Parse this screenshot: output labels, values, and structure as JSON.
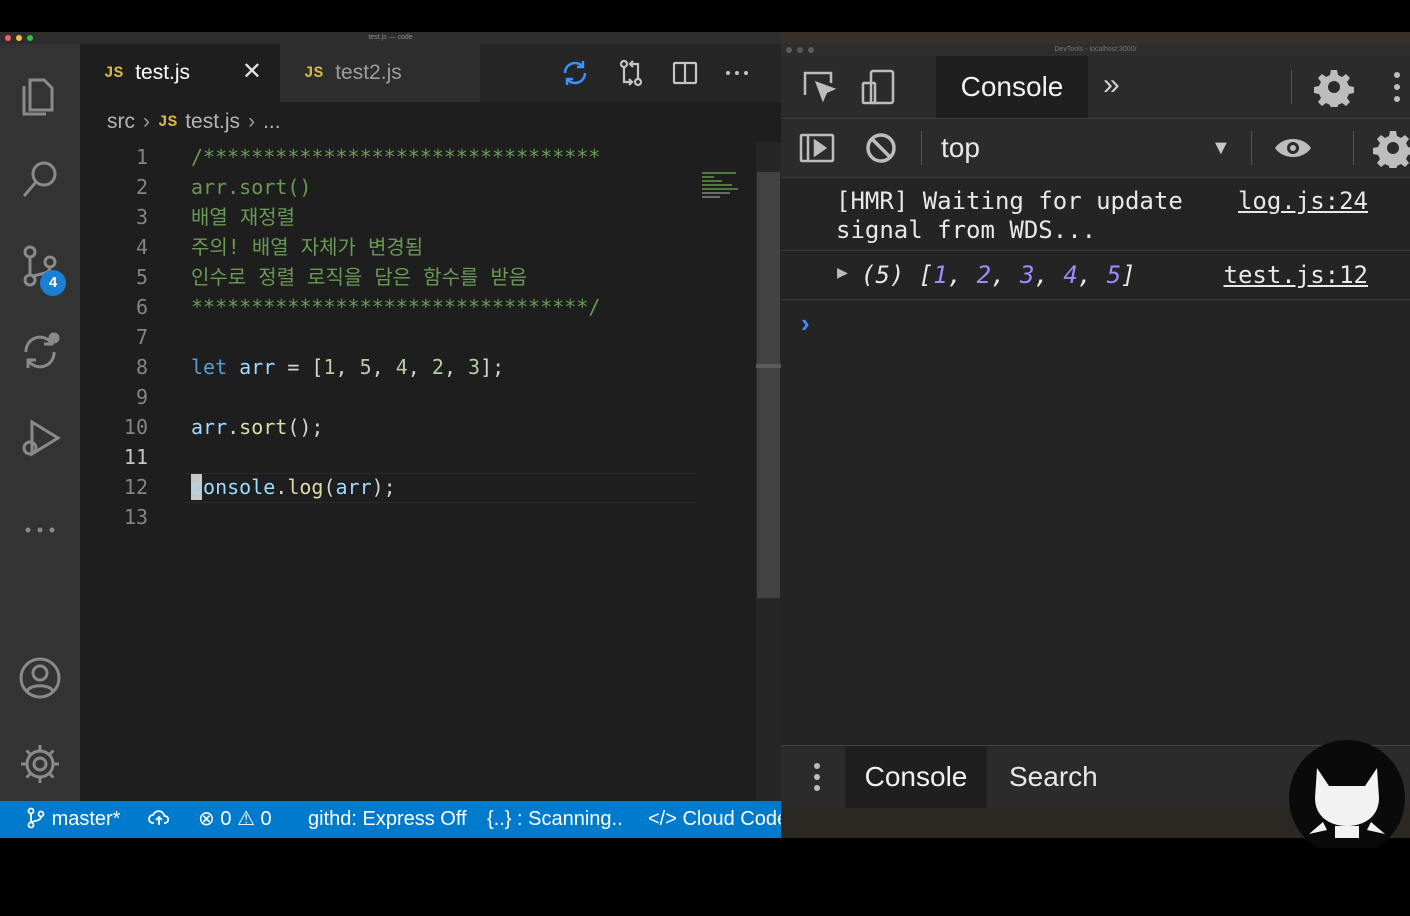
{
  "vscode": {
    "window_title": "test.js — code",
    "activity_badge": "4",
    "tabs": [
      {
        "label": "test.js",
        "icon": "JS"
      },
      {
        "label": "test2.js",
        "icon": "JS"
      }
    ],
    "tab_close": "✕",
    "breadcrumb": {
      "folder": "src",
      "icon": "JS",
      "file": "test.js",
      "tail": "..."
    },
    "editor": {
      "lines": [
        {
          "n": "1",
          "text": "/*********************************"
        },
        {
          "n": "2",
          "text": "arr.sort()"
        },
        {
          "n": "3",
          "text": "배열 재정렬"
        },
        {
          "n": "4",
          "text": "주의! 배열 자체가 변경됨"
        },
        {
          "n": "5",
          "text": "인수로 정렬 로직을 담은 함수를 받음"
        },
        {
          "n": "6",
          "text": "*********************************/"
        },
        {
          "n": "7",
          "text": ""
        },
        {
          "n": "8",
          "parts": [
            "let",
            " ",
            "arr",
            " = [",
            "1",
            ", ",
            "5",
            ", ",
            "4",
            ", ",
            "2",
            ", ",
            "3",
            "];"
          ]
        },
        {
          "n": "9",
          "text": ""
        },
        {
          "n": "10",
          "parts": [
            "arr",
            ".",
            "sort",
            "();"
          ]
        },
        {
          "n": "11",
          "text": ""
        },
        {
          "n": "12",
          "parts": [
            "console",
            ".",
            "log",
            "(",
            "arr",
            ");"
          ]
        },
        {
          "n": "13",
          "text": ""
        }
      ]
    },
    "statusbar": {
      "branch": "master*",
      "errors": "0",
      "warnings": "0",
      "githd": "githd: Express Off",
      "scanning": "{..} : Scanning..",
      "cloud_code": "</> Cloud Code"
    }
  },
  "devtools": {
    "window_title": "DevTools - localhost:3000/",
    "tab_console": "Console",
    "more_tabs": "»",
    "context": "top",
    "context_arrow": "▼",
    "logs": [
      {
        "message_line1": "[HMR] Waiting for update",
        "message_line2": "signal from WDS...",
        "source": "log.js:24"
      },
      {
        "expander": "▶",
        "count": "(5)",
        "values": [
          "1",
          "2",
          "3",
          "4",
          "5"
        ],
        "source": "test.js:12"
      }
    ],
    "prompt": "›",
    "drawer": {
      "console": "Console",
      "search": "Search"
    }
  },
  "colors": {
    "editor_bg": "#1e1e1e",
    "statusbar": "#007acc",
    "comment": "#6a9955",
    "keyword": "#569cd6",
    "variable": "#9cdcfe",
    "function": "#dcdcaa",
    "number": "#b5cea8"
  }
}
